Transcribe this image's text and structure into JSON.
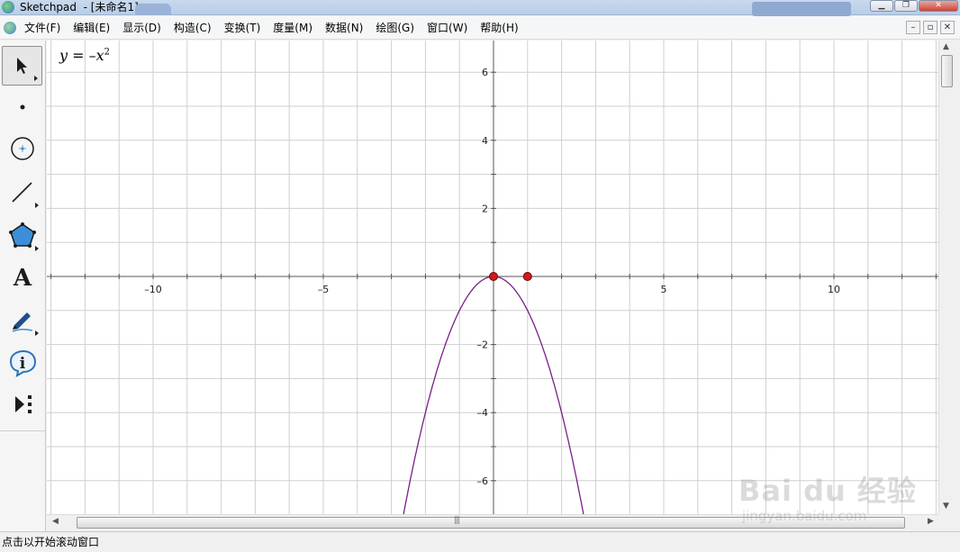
{
  "window": {
    "title": "Sketchpad  - [未命名1]",
    "buttons": [
      "▁",
      "❐",
      "✕"
    ]
  },
  "menu": {
    "items": [
      "文件(F)",
      "编辑(E)",
      "显示(D)",
      "构造(C)",
      "变换(T)",
      "度量(M)",
      "数据(N)",
      "绘图(G)",
      "窗口(W)",
      "帮助(H)"
    ],
    "doc_buttons": [
      "–",
      "▫",
      "✕"
    ]
  },
  "toolbox": {
    "tools": [
      "arrow-select-tool",
      "point-tool",
      "compass-tool",
      "straightedge-tool",
      "polygon-tool",
      "text-tool",
      "marker-tool",
      "information-tool",
      "custom-tool"
    ],
    "selected": "arrow-select-tool"
  },
  "graph": {
    "equation_lhs": "y",
    "equation_mid": " = –",
    "equation_var": "x",
    "equation_exp": "2",
    "x_ticks": [
      "–10",
      "–5",
      "5",
      "10"
    ],
    "y_ticks": [
      "6",
      "4",
      "2",
      "–2",
      "–4",
      "–6"
    ],
    "curve_color": "#7a1f8a",
    "point_color": "#d11a1a"
  },
  "chart_data": {
    "type": "line",
    "title": "",
    "xlabel": "",
    "ylabel": "",
    "xlim": [
      -13,
      13
    ],
    "ylim": [
      -7,
      7
    ],
    "grid": true,
    "series": [
      {
        "name": "y = –x²",
        "x": [
          -2.65,
          -2,
          -1.5,
          -1,
          -0.5,
          0,
          0.5,
          1,
          1.5,
          2,
          2.65
        ],
        "y": [
          -7.02,
          -4,
          -2.25,
          -1,
          -0.25,
          0,
          -0.25,
          -1,
          -2.25,
          -4,
          -7.02
        ]
      }
    ],
    "points": [
      {
        "x": 0,
        "y": 0
      },
      {
        "x": 1,
        "y": 0
      }
    ]
  },
  "status": {
    "text": "点击以开始滚动窗口"
  },
  "watermark": {
    "brand": "Bai du 经验",
    "url": "jingyan.baidu.com"
  }
}
